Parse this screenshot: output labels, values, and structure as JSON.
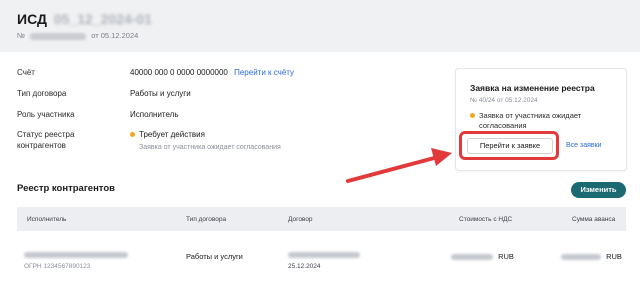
{
  "header": {
    "title_prefix": "ИСД",
    "title_blurred": "05_12_2024-01",
    "sub_no_label": "№",
    "sub_date_text": "от 05.12.2024"
  },
  "details": {
    "account_label": "Счёт",
    "account_value": "40000 000 0 0000 0000000",
    "account_link": "Перейти к счёту",
    "contract_type_label": "Тип договора",
    "contract_type_value": "Работы и услуги",
    "role_label": "Роль участника",
    "role_value": "Исполнитель",
    "registry_status_label_1": "Статус реестра",
    "registry_status_label_2": "контрагентов",
    "registry_status_value": "Требует действия",
    "registry_status_hint": "Заявка от участника ожидает согласования"
  },
  "request_card": {
    "title": "Заявка на изменение реестра",
    "subtitle": "№ 40/24 от 05.12.2024",
    "status_line_1": "Заявка от участника ожидает",
    "status_line_2": "согласования",
    "goto_button": "Перейти к заявке",
    "all_link": "Все заявки"
  },
  "registry": {
    "title": "Реестр контрагентов",
    "edit_button": "Изменить",
    "columns": [
      "Исполнитель",
      "Тип договора",
      "Договор",
      "Стоимость с НДС",
      "Сумма аванса"
    ],
    "rows": [
      {
        "contractor_sub": "ОГРН 1234567890123",
        "contract_type": "Работы и услуги",
        "contract_date": "25.12.2024",
        "cost_currency": "RUB",
        "advance_currency": "RUB"
      }
    ]
  },
  "colors": {
    "accent_blue": "#2a6ad8",
    "status_orange": "#f0a81c",
    "edit_button_teal": "#1b6a72",
    "annotation_red": "#e23a3a"
  }
}
